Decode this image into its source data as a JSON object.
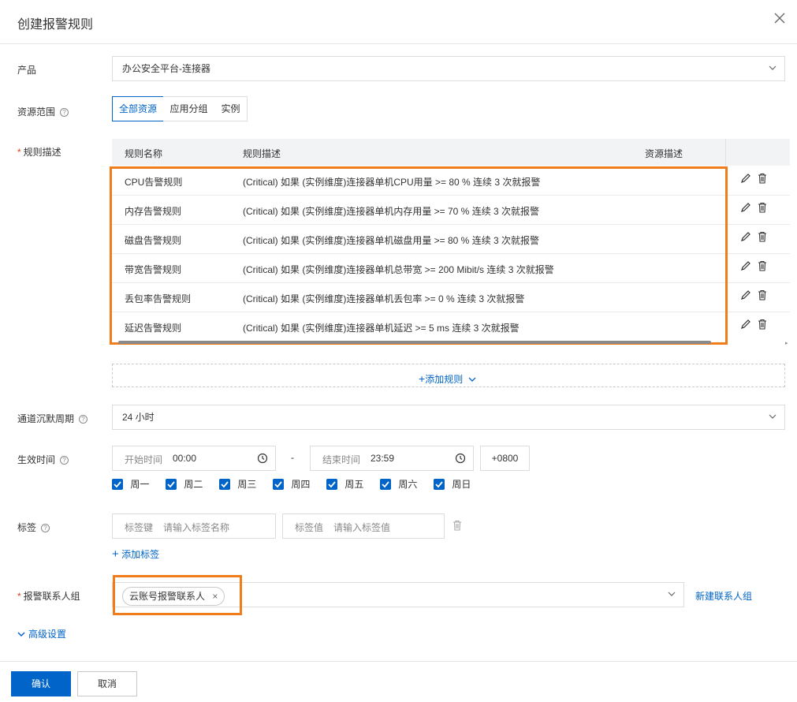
{
  "dialog": {
    "title": "创建报警规则"
  },
  "product": {
    "label": "产品",
    "value": "办公安全平台-连接器"
  },
  "resource_scope": {
    "label": "资源范围",
    "options": [
      "全部资源",
      "应用分组",
      "实例"
    ],
    "selected": "全部资源"
  },
  "rules": {
    "label": "规则描述",
    "columns": [
      "规则名称",
      "规则描述",
      "资源描述"
    ],
    "rows": [
      {
        "name": "CPU告警规则",
        "desc": "(Critical) 如果 (实例维度)连接器单机CPU用量 >= 80 % 连续 3 次就报警"
      },
      {
        "name": "内存告警规则",
        "desc": "(Critical) 如果 (实例维度)连接器单机内存用量 >= 70 % 连续 3 次就报警"
      },
      {
        "name": "磁盘告警规则",
        "desc": "(Critical) 如果 (实例维度)连接器单机磁盘用量 >= 80 % 连续 3 次就报警"
      },
      {
        "name": "带宽告警规则",
        "desc": "(Critical) 如果 (实例维度)连接器单机总带宽 >= 200 Mibit/s 连续 3 次就报警"
      },
      {
        "name": "丢包率告警规则",
        "desc": "(Critical) 如果 (实例维度)连接器单机丢包率 >= 0 % 连续 3 次就报警"
      },
      {
        "name": "延迟告警规则",
        "desc": "(Critical) 如果 (实例维度)连接器单机延迟 >= 5 ms 连续 3 次就报警"
      }
    ],
    "add_rule": "添加规则"
  },
  "silence": {
    "label": "通道沉默周期",
    "value": "24 小时"
  },
  "effective": {
    "label": "生效时间",
    "start_label": "开始时间",
    "start_value": "00:00",
    "end_label": "结束时间",
    "end_value": "23:59",
    "separator": "-",
    "timezone": "+0800",
    "days": [
      "周一",
      "周二",
      "周三",
      "周四",
      "周五",
      "周六",
      "周日"
    ]
  },
  "tags": {
    "label": "标签",
    "key_label": "标签键",
    "key_placeholder": "请输入标签名称",
    "value_label": "标签值",
    "value_placeholder": "请输入标签值",
    "add": "添加标签"
  },
  "contacts": {
    "label": "报警联系人组",
    "selected_tag": "云账号报警联系人",
    "new_link": "新建联系人组"
  },
  "advanced": "高级设置",
  "footer": {
    "confirm": "确认",
    "cancel": "取消"
  },
  "colors": {
    "accent": "#0064c8",
    "highlight": "#f07c1c",
    "required": "#e13d13"
  }
}
